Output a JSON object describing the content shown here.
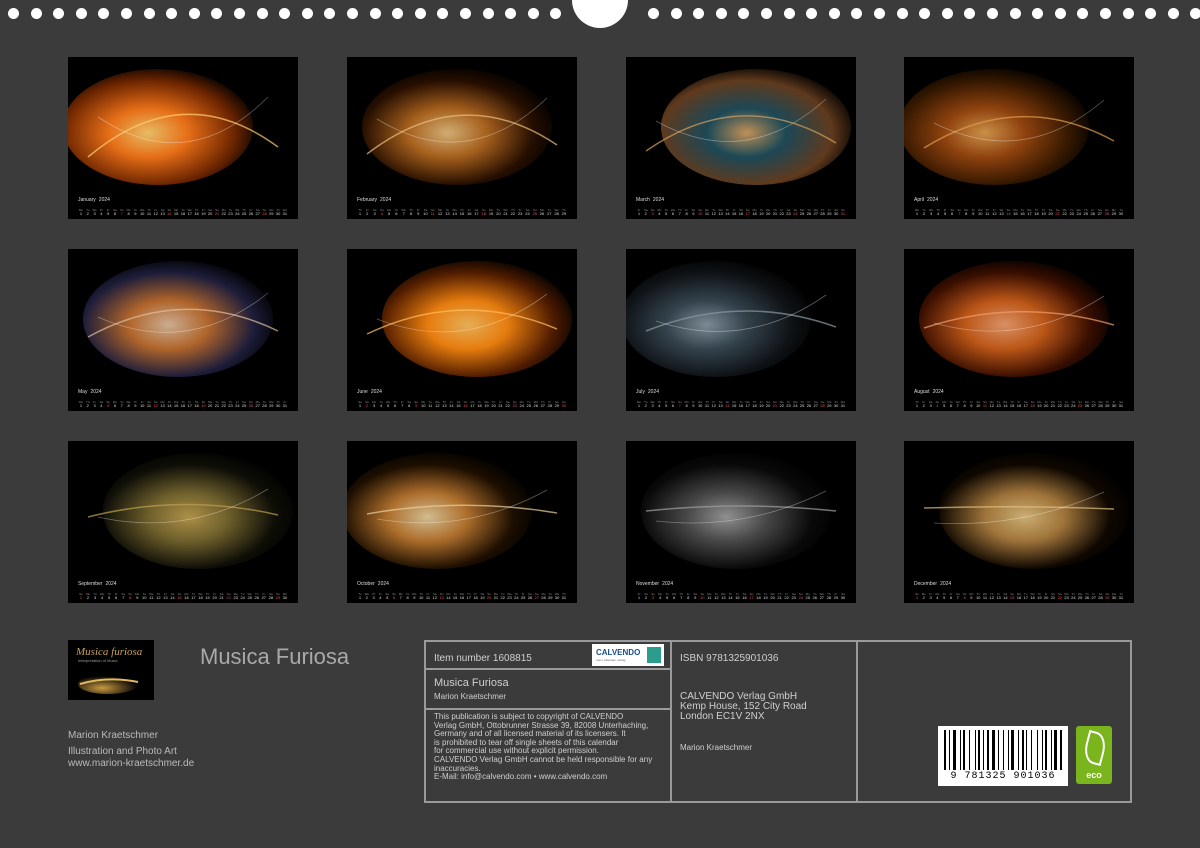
{
  "title": "Musica Furiosa",
  "logo": {
    "title": "Musica furiosa",
    "subtitle": "Interpretation of Music"
  },
  "author": {
    "name": "Marion Kraetschmer",
    "role": "Illustration and Photo Art",
    "website": "www.marion-kraetschmer.de"
  },
  "info": {
    "item_number": "Item number 1608815",
    "isbn": "ISBN 9781325901036",
    "product_title": "Musica Furiosa",
    "product_author": "Marion Kraetschmer",
    "legal": [
      "This publication is subject to copyright of CALVENDO",
      "Verlag GmbH, Ottobrunner Strasse 39, 82008 Unterhaching,",
      "Germany and of all licensed material of its licensers. It",
      "is prohibited to tear off single sheets of this calendar",
      "for commercial use without explicit permission.",
      "CALVENDO Verlag GmbH cannot be held responsible for any",
      "inaccuracies.",
      "E-Mail: info@calvendo.com • www.calvendo.com"
    ],
    "publisher": [
      "CALVENDO Verlag GmbH",
      "Kemp House, 152 City Road",
      "London EC1V 2NX"
    ],
    "publisher_author": "Marion Kraetschmer",
    "calvendo_logo": {
      "word": "CALVENDO",
      "slogan": "mein. kalender. verlag."
    },
    "barcode_number": "9 781325 901036",
    "eco_label": "eco"
  },
  "year": "2024",
  "months": [
    {
      "name": "January",
      "days": 31,
      "start": 0,
      "colors": [
        "#ff7a1a",
        "#7a2a00",
        "#ffd070"
      ]
    },
    {
      "name": "February",
      "days": 29,
      "start": 3,
      "colors": [
        "#b86a20",
        "#2a1000",
        "#e8c080"
      ]
    },
    {
      "name": "March",
      "days": 31,
      "start": 4,
      "colors": [
        "#1f5060",
        "#6a4020",
        "#d4a060"
      ]
    },
    {
      "name": "April",
      "days": 30,
      "start": 0,
      "colors": [
        "#a04a10",
        "#3a1a00",
        "#e0a050"
      ]
    },
    {
      "name": "May",
      "days": 31,
      "start": 2,
      "colors": [
        "#c47030",
        "#202040",
        "#e0c0a0"
      ]
    },
    {
      "name": "June",
      "days": 30,
      "start": 5,
      "colors": [
        "#ff8a10",
        "#5a2000",
        "#ffc060"
      ]
    },
    {
      "name": "July",
      "days": 31,
      "start": 0,
      "colors": [
        "#3a4a55",
        "#101418",
        "#8a9aa5"
      ]
    },
    {
      "name": "August",
      "days": 31,
      "start": 3,
      "colors": [
        "#d0601a",
        "#401000",
        "#f0a070"
      ]
    },
    {
      "name": "September",
      "days": 30,
      "start": 6,
      "colors": [
        "#7a6a30",
        "#101008",
        "#c0a050"
      ]
    },
    {
      "name": "October",
      "days": 31,
      "start": 1,
      "colors": [
        "#c07a30",
        "#201000",
        "#e8d0a0"
      ]
    },
    {
      "name": "November",
      "days": 30,
      "start": 4,
      "colors": [
        "#505050",
        "#0a0a0a",
        "#a0a0a0"
      ]
    },
    {
      "name": "December",
      "days": 31,
      "start": 6,
      "colors": [
        "#b08040",
        "#100800",
        "#e0c080"
      ]
    }
  ],
  "weekday_abbr": [
    "Mo",
    "Tu",
    "We",
    "Th",
    "Fr",
    "Sa",
    "Su"
  ]
}
